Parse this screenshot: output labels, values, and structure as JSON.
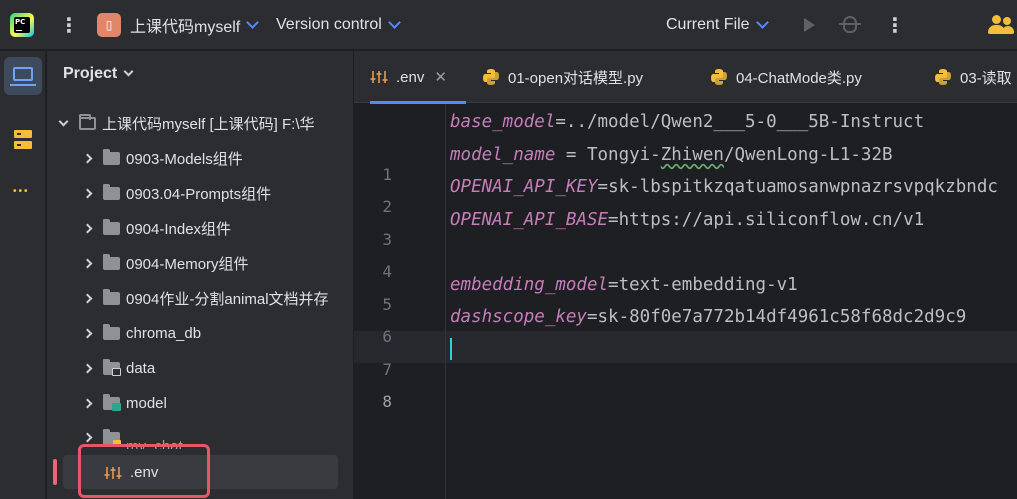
{
  "titlebar": {
    "project_badge": "\u0000",
    "project_name": "上课代码myself",
    "vcs_label": "Version control",
    "run_config": "Current File"
  },
  "project_pane": {
    "title": "Project",
    "root": "上课代码myself [上课代码]  F:\\华",
    "items": [
      {
        "label": "0903-Models组件",
        "icon": "folder-icon"
      },
      {
        "label": "0903.04-Prompts组件",
        "icon": "folder-icon"
      },
      {
        "label": "0904-Index组件",
        "icon": "folder-icon"
      },
      {
        "label": "0904-Memory组件",
        "icon": "folder-icon"
      },
      {
        "label": "0904作业-分割animal文档并存",
        "icon": "folder-icon"
      },
      {
        "label": "chroma_db",
        "icon": "folder-icon"
      },
      {
        "label": "data",
        "icon": "locked-folder-icon"
      },
      {
        "label": "model",
        "icon": "module-folder-icon"
      },
      {
        "label": "my_chat",
        "icon": "folder-icon"
      }
    ],
    "selected_file": ".env"
  },
  "tabs": [
    {
      "label": ".env",
      "icon": "settings-file-icon",
      "active": true
    },
    {
      "label": "01-open对话模型.py",
      "icon": "python-icon"
    },
    {
      "label": "04-ChatMode类.py",
      "icon": "python-icon"
    },
    {
      "label": "03-读取",
      "icon": "python-icon"
    }
  ],
  "editor": {
    "line_numbers": [
      "1",
      "2",
      "3",
      "4",
      "5",
      "6",
      "7",
      "8"
    ],
    "current_line": 8,
    "lines": [
      {
        "key": "base_model",
        "sep": "=",
        "value": "../model/Qwen2___5-0___5B-Instruct"
      },
      {
        "key": "model_name",
        "sep": " = ",
        "value_pre": "Tongyi-",
        "value_typo": "Zhiwen",
        "value_post": "/QwenLong-L1-32B"
      },
      {
        "key": "OPENAI_API_KEY",
        "sep": "=",
        "value": "sk-lbspitkzqatuamosanwpnazrsvpqkzbndc"
      },
      {
        "key": "OPENAI_API_BASE",
        "sep": "=",
        "value": "https://api.siliconflow.cn/v1"
      },
      {
        "key": "embedding_model",
        "sep": "=",
        "value": "text-embedding-v1"
      },
      {
        "key": "dashscope_key",
        "sep": "=",
        "value": "sk-80f0e7a772b14df4961c58f68dc2d9c9"
      }
    ]
  },
  "colors": {
    "accent": "#548af7",
    "key_color": "#c77dbb",
    "highlight_box": "#e8566a"
  }
}
